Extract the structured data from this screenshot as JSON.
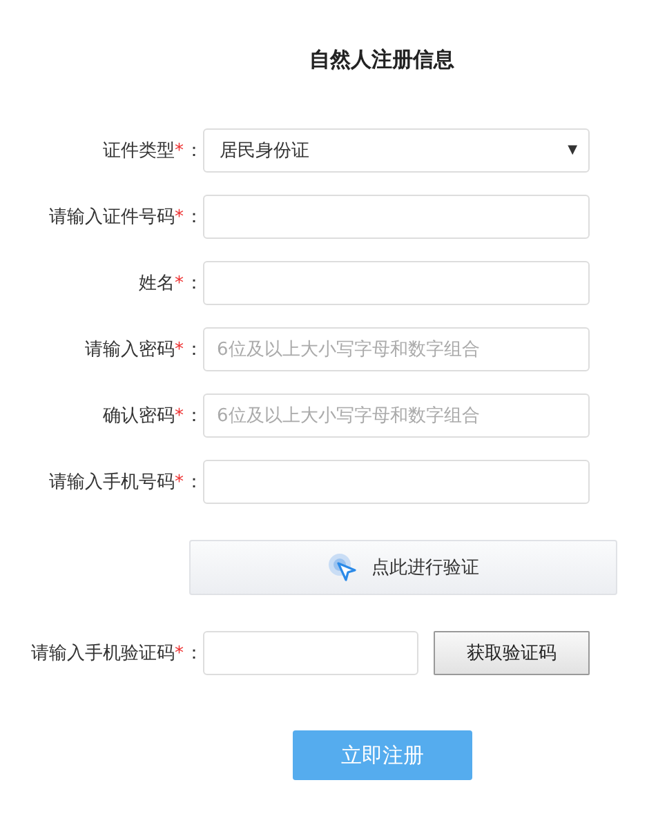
{
  "title": "自然人注册信息",
  "fields": [
    {
      "kind": "select",
      "label": "证件类型",
      "mark": "*",
      "colon": "：",
      "value": "居民身份证",
      "caret": "▼"
    },
    {
      "kind": "text",
      "label": "请输入证件号码",
      "mark": "*",
      "colon": "："
    },
    {
      "kind": "text",
      "label": "姓名",
      "mark": "*",
      "colon": "："
    },
    {
      "kind": "text",
      "label": "请输入密码",
      "mark": "*",
      "colon": "：",
      "placeholder": "6位及以上大小写字母和数字组合"
    },
    {
      "kind": "text",
      "label": "确认密码",
      "mark": "*",
      "colon": "：",
      "placeholder": "6位及以上大小写字母和数字组合"
    },
    {
      "kind": "text",
      "label": "请输入手机号码",
      "mark": "*",
      "colon": "："
    }
  ],
  "verify_button": {
    "label": "点此进行验证"
  },
  "sms_code": {
    "label": "请输入手机验证码",
    "mark": "*",
    "colon": "：",
    "button": "获取验证码"
  },
  "submit_button": "立即注册"
}
